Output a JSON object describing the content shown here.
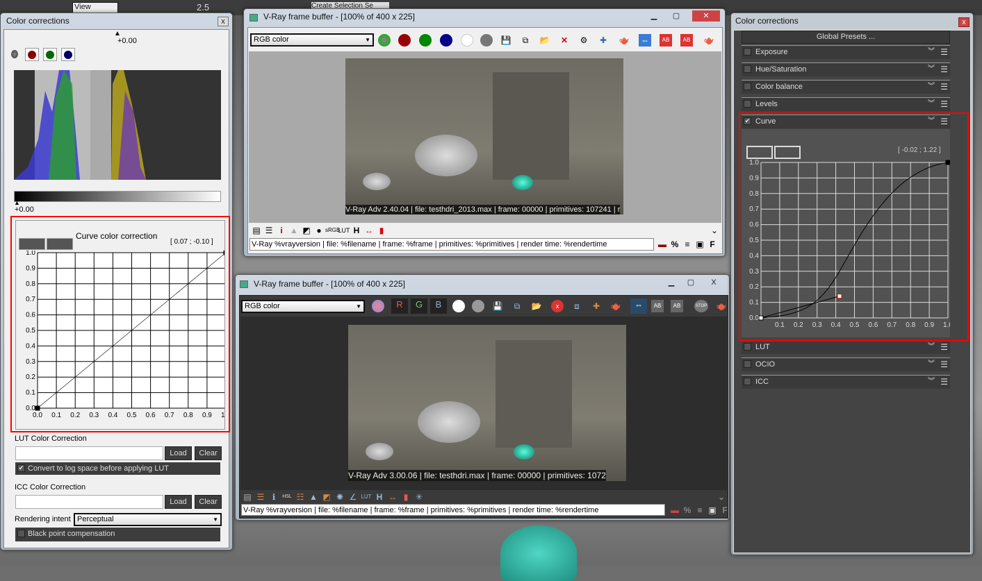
{
  "app_toolbar": {
    "view_select": "View",
    "value": "2.5",
    "selection_set": "Create Selection Se"
  },
  "left_panel": {
    "title": "Color corrections",
    "exposure_marker": "+0.00",
    "gradient_marker": "+0.00",
    "channel_buttons": [
      "rgb",
      "red",
      "green",
      "blue"
    ],
    "curve": {
      "title": "Curve color correction",
      "readout": "[ 0.07 ; -0.10 ]",
      "y_ticks": [
        "1.0",
        "0.9",
        "0.8",
        "0.7",
        "0.6",
        "0.5",
        "0.4",
        "0.3",
        "0.2",
        "0.1",
        "0.0"
      ],
      "x_ticks": [
        "0.0",
        "0.1",
        "0.2",
        "0.3",
        "0.4",
        "0.5",
        "0.6",
        "0.7",
        "0.8",
        "0.9",
        "1.0"
      ],
      "points": [
        [
          0,
          0
        ],
        [
          1,
          1
        ]
      ]
    },
    "lut": {
      "label": "LUT Color Correction",
      "value": "",
      "load": "Load",
      "clear": "Clear",
      "log_checkbox": "Convert to log space before applying LUT",
      "log_checked": true
    },
    "icc": {
      "label": "ICC Color Correction",
      "value": "",
      "load": "Load",
      "clear": "Clear",
      "intent_label": "Rendering intent",
      "intent_value": "Perceptual",
      "bpc_checkbox": "Black point compensation",
      "bpc_checked": false
    }
  },
  "vfb1": {
    "title": "V-Ray frame buffer - [100% of 400 x 225]",
    "channel_select": "RGB color",
    "stamp": "V-Ray Adv 2.40.04 | file: testhdri_2013.max | frame: 00000 | primitives: 107241 | r",
    "bottom_icons": [
      "i",
      "LUT",
      "H"
    ],
    "status_template": "V-Ray %vrayversion | file: %filename | frame: %frame | primitives: %primitives | render time: %rendertime",
    "right_icons": [
      "%",
      "F"
    ]
  },
  "vfb2": {
    "title": "V-Ray frame buffer - [100% of 400 x 225]",
    "channel_select": "RGB color",
    "channel_buttons": [
      "R",
      "G",
      "B"
    ],
    "stop": "STOP",
    "stamp": "V-Ray Adv 3.00.06 | file: testhdri.max | frame: 00000 | primitives: 1072",
    "bottom_icons": [
      "HSL",
      "LUT",
      "H"
    ],
    "status_template": "V-Ray %vrayversion | file: %filename | frame: %frame | primitives: %primitives | render time: %rendertime",
    "right_icons": [
      "%",
      "F"
    ]
  },
  "right_panel": {
    "title": "Color corrections",
    "global_presets": "Global Presets ...",
    "layers": [
      {
        "label": "Exposure",
        "checked": false
      },
      {
        "label": "Hue/Saturation",
        "checked": false
      },
      {
        "label": "Color balance",
        "checked": false
      },
      {
        "label": "Levels",
        "checked": false
      },
      {
        "label": "Curve",
        "checked": true
      },
      {
        "label": "LUT",
        "checked": false
      },
      {
        "label": "OCIO",
        "checked": false
      },
      {
        "label": "ICC",
        "checked": false
      }
    ],
    "curve": {
      "readout": "[ -0.02 ; 1.22 ]",
      "y_ticks": [
        "1.0",
        "0.9",
        "0.8",
        "0.7",
        "0.6",
        "0.5",
        "0.4",
        "0.3",
        "0.2",
        "0.1",
        "0.0"
      ],
      "x_ticks": [
        "0.1",
        "0.2",
        "0.3",
        "0.4",
        "0.5",
        "0.6",
        "0.7",
        "0.8",
        "0.9",
        "1.0"
      ],
      "points": [
        [
          0,
          0
        ],
        [
          0.42,
          0.14
        ],
        [
          1,
          1
        ]
      ]
    }
  },
  "colors": {
    "highlight_red": "#ff0000",
    "dark_panel": "#444444",
    "accent_blue": "#3a7bd5"
  }
}
